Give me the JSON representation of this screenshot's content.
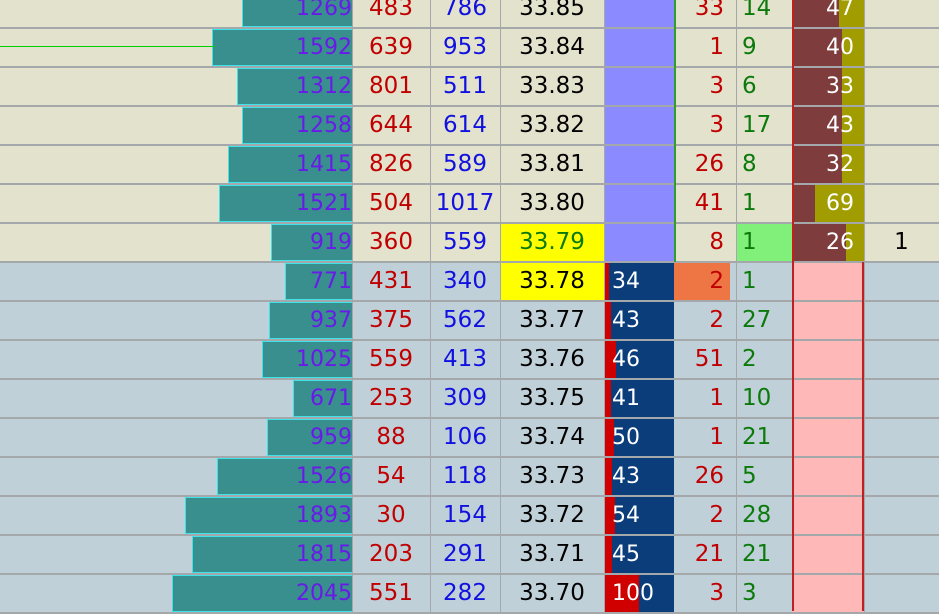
{
  "ladder": {
    "rows": [
      {
        "vol": "1269",
        "vol_frac": 0.61,
        "bid": "483",
        "ask": "786",
        "price": "33.85",
        "delta": "",
        "sold": "33",
        "bought": "14",
        "imb": "47",
        "imb_frac": 0.35,
        "extra": "",
        "zone": "ask"
      },
      {
        "vol": "1592",
        "vol_frac": 0.78,
        "bid": "639",
        "ask": "953",
        "price": "33.84",
        "delta": "",
        "sold": "1",
        "bought": "9",
        "imb": "40",
        "imb_frac": 0.3,
        "extra": "",
        "zone": "ask"
      },
      {
        "vol": "1312",
        "vol_frac": 0.64,
        "bid": "801",
        "ask": "511",
        "price": "33.83",
        "delta": "",
        "sold": "3",
        "bought": "6",
        "imb": "33",
        "imb_frac": 0.3,
        "extra": "",
        "zone": "ask"
      },
      {
        "vol": "1258",
        "vol_frac": 0.61,
        "bid": "644",
        "ask": "614",
        "price": "33.82",
        "delta": "",
        "sold": "3",
        "bought": "17",
        "imb": "43",
        "imb_frac": 0.3,
        "extra": "",
        "zone": "ask"
      },
      {
        "vol": "1415",
        "vol_frac": 0.69,
        "bid": "826",
        "ask": "589",
        "price": "33.81",
        "delta": "",
        "sold": "26",
        "bought": "8",
        "imb": "32",
        "imb_frac": 0.3,
        "extra": "",
        "zone": "ask"
      },
      {
        "vol": "1521",
        "vol_frac": 0.74,
        "bid": "504",
        "ask": "1017",
        "price": "33.80",
        "delta": "",
        "sold": "41",
        "bought": "1",
        "imb": "69",
        "imb_frac": 0.68,
        "extra": "",
        "zone": "ask"
      },
      {
        "vol": "919",
        "vol_frac": 0.45,
        "bid": "360",
        "ask": "559",
        "price": "33.79",
        "delta": "",
        "sold": "8",
        "bought": "1",
        "imb": "26",
        "imb_frac": 0.25,
        "extra": "1",
        "zone": "last"
      },
      {
        "vol": "771",
        "vol_frac": 0.37,
        "bid": "431",
        "ask": "340",
        "price": "33.78",
        "delta": "34",
        "delta_frac": 0.07,
        "sold": "2",
        "bought": "1",
        "imb": "",
        "imb_frac": 0,
        "extra": "",
        "zone": "bid"
      },
      {
        "vol": "937",
        "vol_frac": 0.46,
        "bid": "375",
        "ask": "562",
        "price": "33.77",
        "delta": "43",
        "delta_frac": 0.1,
        "sold": "2",
        "bought": "27",
        "imb": "",
        "imb_frac": 0,
        "extra": "",
        "zone": "bid"
      },
      {
        "vol": "1025",
        "vol_frac": 0.5,
        "bid": "559",
        "ask": "413",
        "price": "33.76",
        "delta": "46",
        "delta_frac": 0.17,
        "sold": "51",
        "bought": "2",
        "imb": "",
        "imb_frac": 0,
        "extra": "",
        "zone": "bid"
      },
      {
        "vol": "671",
        "vol_frac": 0.33,
        "bid": "253",
        "ask": "309",
        "price": "33.75",
        "delta": "41",
        "delta_frac": 0.1,
        "sold": "1",
        "bought": "10",
        "imb": "",
        "imb_frac": 0,
        "extra": "",
        "zone": "bid"
      },
      {
        "vol": "959",
        "vol_frac": 0.47,
        "bid": "88",
        "ask": "106",
        "price": "33.74",
        "delta": "50",
        "delta_frac": 0.14,
        "sold": "1",
        "bought": "21",
        "imb": "",
        "imb_frac": 0,
        "extra": "",
        "zone": "bid"
      },
      {
        "vol": "1526",
        "vol_frac": 0.75,
        "bid": "54",
        "ask": "118",
        "price": "33.73",
        "delta": "43",
        "delta_frac": 0.11,
        "sold": "26",
        "bought": "5",
        "imb": "",
        "imb_frac": 0,
        "extra": "",
        "zone": "bid"
      },
      {
        "vol": "1893",
        "vol_frac": 0.93,
        "bid": "30",
        "ask": "154",
        "price": "33.72",
        "delta": "54",
        "delta_frac": 0.16,
        "sold": "2",
        "bought": "28",
        "imb": "",
        "imb_frac": 0,
        "extra": "",
        "zone": "bid"
      },
      {
        "vol": "1815",
        "vol_frac": 0.89,
        "bid": "203",
        "ask": "291",
        "price": "33.71",
        "delta": "45",
        "delta_frac": 0.11,
        "sold": "21",
        "bought": "21",
        "imb": "",
        "imb_frac": 0,
        "extra": "",
        "zone": "bid"
      },
      {
        "vol": "2045",
        "vol_frac": 1.0,
        "bid": "551",
        "ask": "282",
        "price": "33.70",
        "delta": "100",
        "delta_frac": 0.5,
        "sold": "3",
        "bought": "3",
        "imb": "",
        "imb_frac": 0,
        "extra": "",
        "zone": "bid"
      }
    ],
    "highlight_prices": [
      "33.79",
      "33.78"
    ],
    "colors": {
      "ask_bg": "#e3e2cd",
      "bid_bg": "#c0d0d9",
      "volume_bar": "#398f8e",
      "price_highlight": "#ffff00"
    }
  }
}
